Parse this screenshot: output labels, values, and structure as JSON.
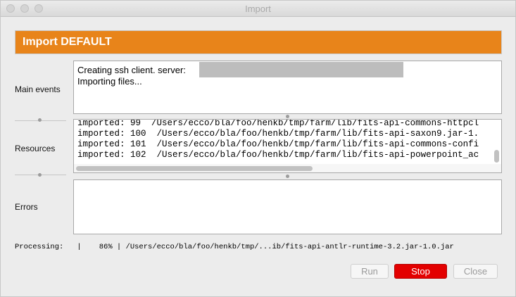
{
  "window": {
    "title": "Import"
  },
  "header": {
    "title": "Import DEFAULT",
    "color": "#e8841a"
  },
  "sections": {
    "main_events_label": "Main events",
    "resources_label": "Resources",
    "errors_label": "Errors"
  },
  "main_events": {
    "lines": [
      "Creating ssh client.   server:",
      "Importing files..."
    ]
  },
  "resources": {
    "lines": [
      "imported: 99  /Users/ecco/bla/foo/henkb/tmp/farm/lib/fits-api-commons-httpcl",
      "imported: 100  /Users/ecco/bla/foo/henkb/tmp/farm/lib/fits-api-saxon9.jar-1.",
      "imported: 101  /Users/ecco/bla/foo/henkb/tmp/farm/lib/fits-api-commons-confi",
      "imported: 102  /Users/ecco/bla/foo/henkb/tmp/farm/lib/fits-api-powerpoint_ac"
    ]
  },
  "errors": {
    "lines": []
  },
  "status": {
    "text": "Processing:   |    86% | /Users/ecco/bla/foo/henkb/tmp/...ib/fits-api-antlr-runtime-3.2.jar-1.0.jar"
  },
  "buttons": {
    "run": "Run",
    "stop": "Stop",
    "close": "Close",
    "stop_color": "#e30000"
  }
}
